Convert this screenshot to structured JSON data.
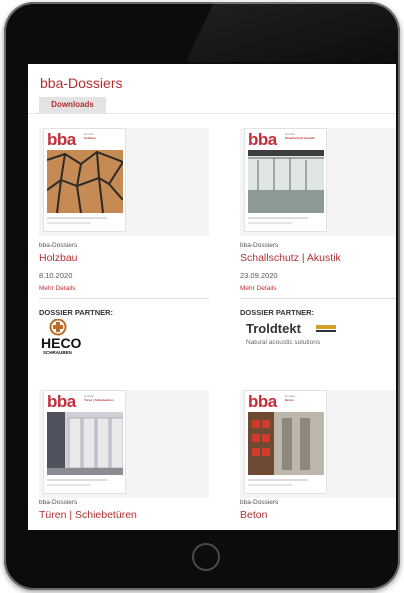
{
  "page": {
    "title": "bba-Dossiers",
    "tab": "Downloads"
  },
  "cards": [
    {
      "cover_logo": "bba",
      "cover_sub": "Dossier",
      "cover_topic": "Holzbau",
      "category": "bba-Dossiers",
      "title": "Holzbau",
      "date": "8.10.2020",
      "more": "Mehr Details",
      "partner_label": "DOSSIER PARTNER:",
      "partner_name": "HECO",
      "partner_sub": "SCHRAUBEN"
    },
    {
      "cover_logo": "bba",
      "cover_sub": "Dossier",
      "cover_topic": "Schallschutz Akustik",
      "category": "bba-Dossiers",
      "title": "Schallschutz | Akustik",
      "date": "23.09.2020",
      "more": "Mehr Details",
      "partner_label": "DOSSIER PARTNER:",
      "partner_name": "Troldtekt",
      "partner_sub": "Natural acoustic solutions"
    },
    {
      "cover_logo": "bba",
      "cover_sub": "Dossier",
      "cover_topic": "Türen | Schiebetüren",
      "category": "bba-Dossiers",
      "title": "Türen | Schiebetüren"
    },
    {
      "cover_logo": "bba",
      "cover_sub": "Dossier",
      "cover_topic": "Beton",
      "category": "bba-Dossiers",
      "title": "Beton"
    }
  ],
  "colors": {
    "accent": "#b03030",
    "tab_bg": "#e3e3e3",
    "device": "#0c0c0c"
  }
}
